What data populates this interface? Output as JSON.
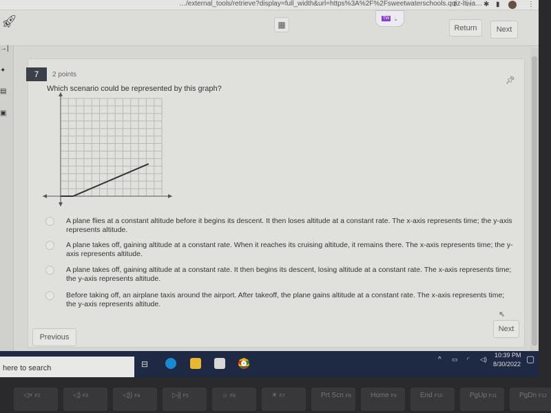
{
  "browser": {
    "url": "…/external_tools/retrieve?display=full_width&url=https%3A%2F%2Fsweetwaterschools.quiz-lti-ia…",
    "icons": [
      "share-icon",
      "star-icon",
      "extensions-icon",
      "sidebar-icon",
      "profile-avatar",
      "menu-icon"
    ]
  },
  "toolbar": {
    "return_label": "Return",
    "next_label": "Next",
    "extension_badge": "TW"
  },
  "question": {
    "number": "7",
    "points": "2 points",
    "text": "Which scenario could be represented by this graph?"
  },
  "chart_data": {
    "type": "line",
    "grid": true,
    "xlim": [
      0,
      13
    ],
    "ylim": [
      0,
      13
    ],
    "series": [
      {
        "x": [
          0,
          1.6,
          11.3
        ],
        "y": [
          0,
          0,
          4.3
        ]
      }
    ],
    "axes_arrows": true,
    "title": "",
    "xlabel": "",
    "ylabel": ""
  },
  "options": [
    "A plane flies at a constant altitude before it begins its descent. It then loses altitude at a constant rate. The x-axis represents time; the y-axis represents altitude.",
    "A plane takes off, gaining altitude at a constant rate. When it reaches its cruising altitude, it remains there. The x-axis represents time; the y-axis represents altitude.",
    "A plane takes off, gaining altitude at a constant rate. It then begins its descent, losing altitude at a constant rate. The x-axis represents time; the y-axis represents altitude.",
    "Before taking off, an airplane taxis around the airport. After takeoff, the plane gains altitude at a constant rate. The x-axis represents time; the y-axis represents altitude."
  ],
  "footer": {
    "previous_label": "Previous",
    "next_label": "Next"
  },
  "taskbar": {
    "search_placeholder": "here to search",
    "time": "10:39 PM",
    "date": "8/30/2022"
  },
  "keyboard": [
    {
      "label": "◁×",
      "fn": "F2"
    },
    {
      "label": "◁)",
      "fn": "F3"
    },
    {
      "label": "◁))",
      "fn": "F4"
    },
    {
      "label": "▷||",
      "fn": "F5"
    },
    {
      "label": "☼",
      "fn": "F6"
    },
    {
      "label": "☀",
      "fn": "F7"
    },
    {
      "label": "Prt Scn",
      "fn": "F8"
    },
    {
      "label": "Home",
      "fn": "F9"
    },
    {
      "label": "End",
      "fn": "F10"
    },
    {
      "label": "PgUp",
      "fn": "F11"
    },
    {
      "label": "PgDn",
      "fn": "F12"
    }
  ]
}
